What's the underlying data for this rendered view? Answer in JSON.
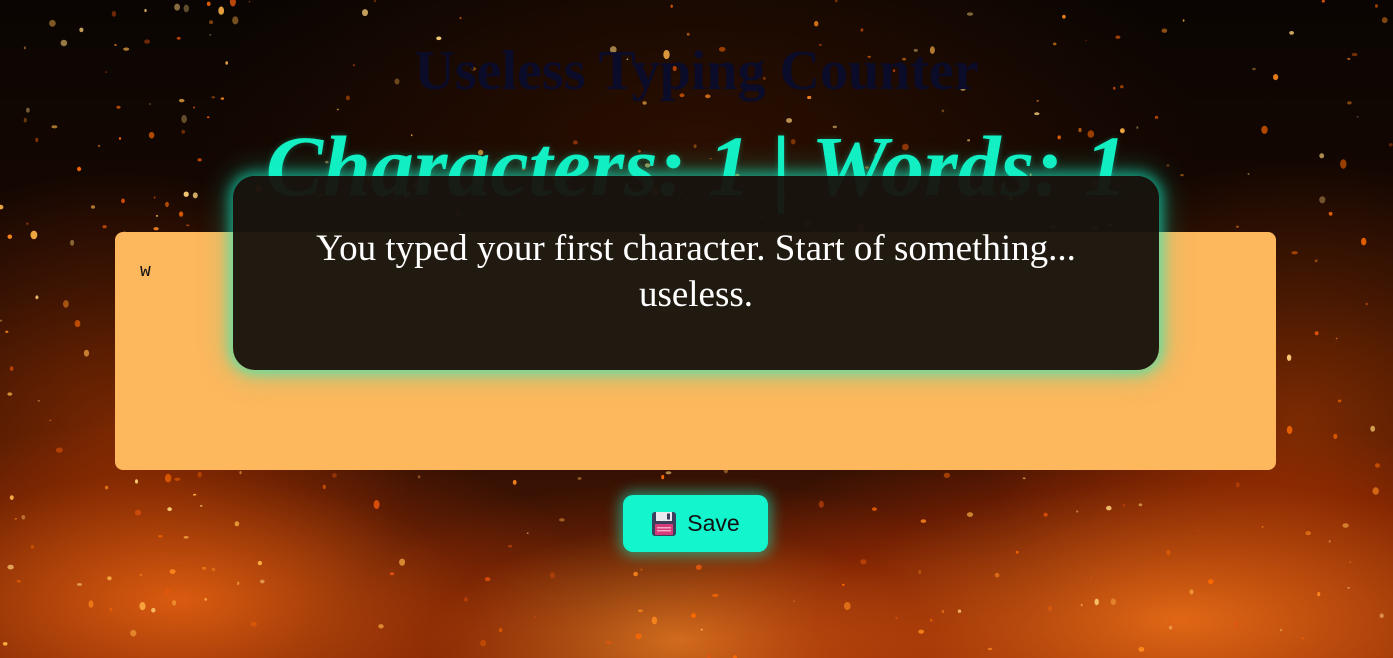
{
  "header": {
    "title": "Useless Typing Counter"
  },
  "counter": {
    "text": "Characters: 1 | Words: 1"
  },
  "editor": {
    "value": "w"
  },
  "toast": {
    "message": "You typed your first character. Start of something... useless."
  },
  "toolbar": {
    "save_label": "Save",
    "save_icon": "floppy-disk-icon"
  },
  "colors": {
    "accent": "#13f5cc",
    "editor_bg": "#fdb75c",
    "title": "#0b0b2a"
  }
}
